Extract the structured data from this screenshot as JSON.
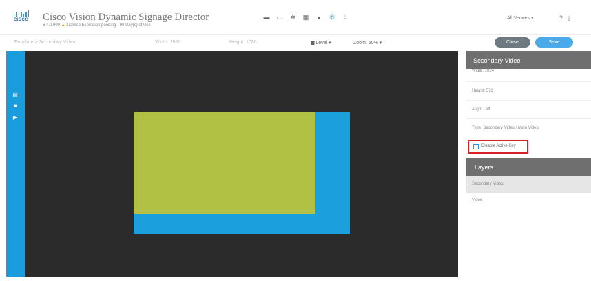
{
  "header": {
    "brand_word": "CISCO",
    "title": "Cisco Vision Dynamic Signage Director",
    "subtitle_version": "6.4.0.999",
    "subtitle_warning": "License Expiration pending - 90 Day(s) of Use",
    "toolbar_icons": [
      "folder-icon",
      "monitor-icon",
      "gear-icon",
      "grid-icon",
      "chart-icon",
      "phone-icon",
      "apps-icon"
    ],
    "user_label": "All Venues",
    "user_caret": "▾",
    "right_icons": [
      "help-icon",
      "download-icon"
    ]
  },
  "subbar": {
    "breadcrumb": "Template > Secondary Video",
    "width_label": "Width: 1920",
    "height_label": "Height: 1080",
    "level_label": "Level",
    "zoom_label": "Zoom: 50%",
    "caret": "▾",
    "close_label": "Close",
    "save_label": "Save"
  },
  "rail": {
    "icons": [
      "layers-icon",
      "video-icon",
      "flag-icon"
    ],
    "color": "#1a9ddd"
  },
  "canvas": {
    "background": "#2b2b2b",
    "blue_region": "#1ba0dd",
    "green_region": "#b1c144"
  },
  "panel": {
    "title": "Secondary Video",
    "props": {
      "width": "Width: 1024",
      "height": "Height: 576",
      "align": "Align: Left",
      "type": "Type: Secondary Video / Main Video",
      "checkbox_label": "Disable Active Key"
    },
    "layers_title": "Layers",
    "layers": [
      "Secondary Video",
      "Video"
    ]
  }
}
